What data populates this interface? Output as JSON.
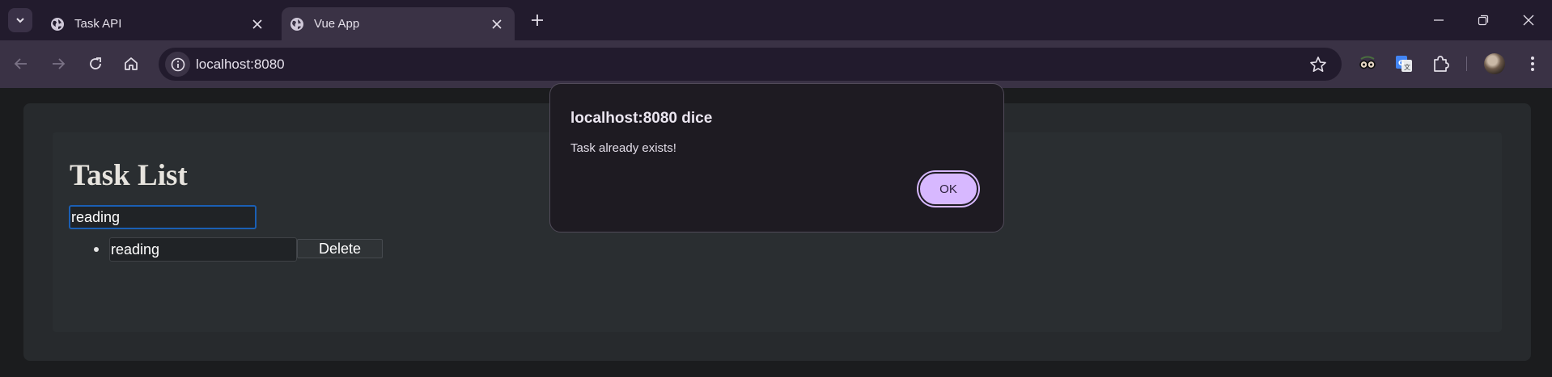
{
  "browser": {
    "tabs": [
      {
        "title": "Task API",
        "active": false
      },
      {
        "title": "Vue App",
        "active": true
      }
    ],
    "url": "localhost:8080"
  },
  "app": {
    "heading": "Task List",
    "new_task_input": {
      "value": "reading"
    },
    "tasks": [
      {
        "value": "reading",
        "delete_label": "Delete"
      }
    ]
  },
  "dialog": {
    "title": "localhost:8080 dice",
    "message": "Task already exists!",
    "ok_label": "OK"
  },
  "colors": {
    "tab_strip": "#221b2d",
    "toolbar": "#3a3245",
    "page_bg": "#1b1c1e",
    "card_bg": "#272a2d",
    "dialog_bg": "#1e1b22",
    "ok_button": "#d7b8ff",
    "focus_ring": "#1a5fb4"
  },
  "icons": {
    "tab_search": "chevron-down-icon",
    "favicon": "globe-icon",
    "tab_close": "close-icon",
    "new_tab": "plus-icon",
    "back": "arrow-left-icon",
    "forward": "arrow-right-icon",
    "reload": "reload-icon",
    "home": "home-icon",
    "site_info": "info-icon",
    "bookmark": "star-icon",
    "extensions": [
      "glasses-extension-icon",
      "translate-extension-icon",
      "puzzle-icon"
    ],
    "profile": "avatar",
    "menu": "kebab-menu-icon"
  }
}
